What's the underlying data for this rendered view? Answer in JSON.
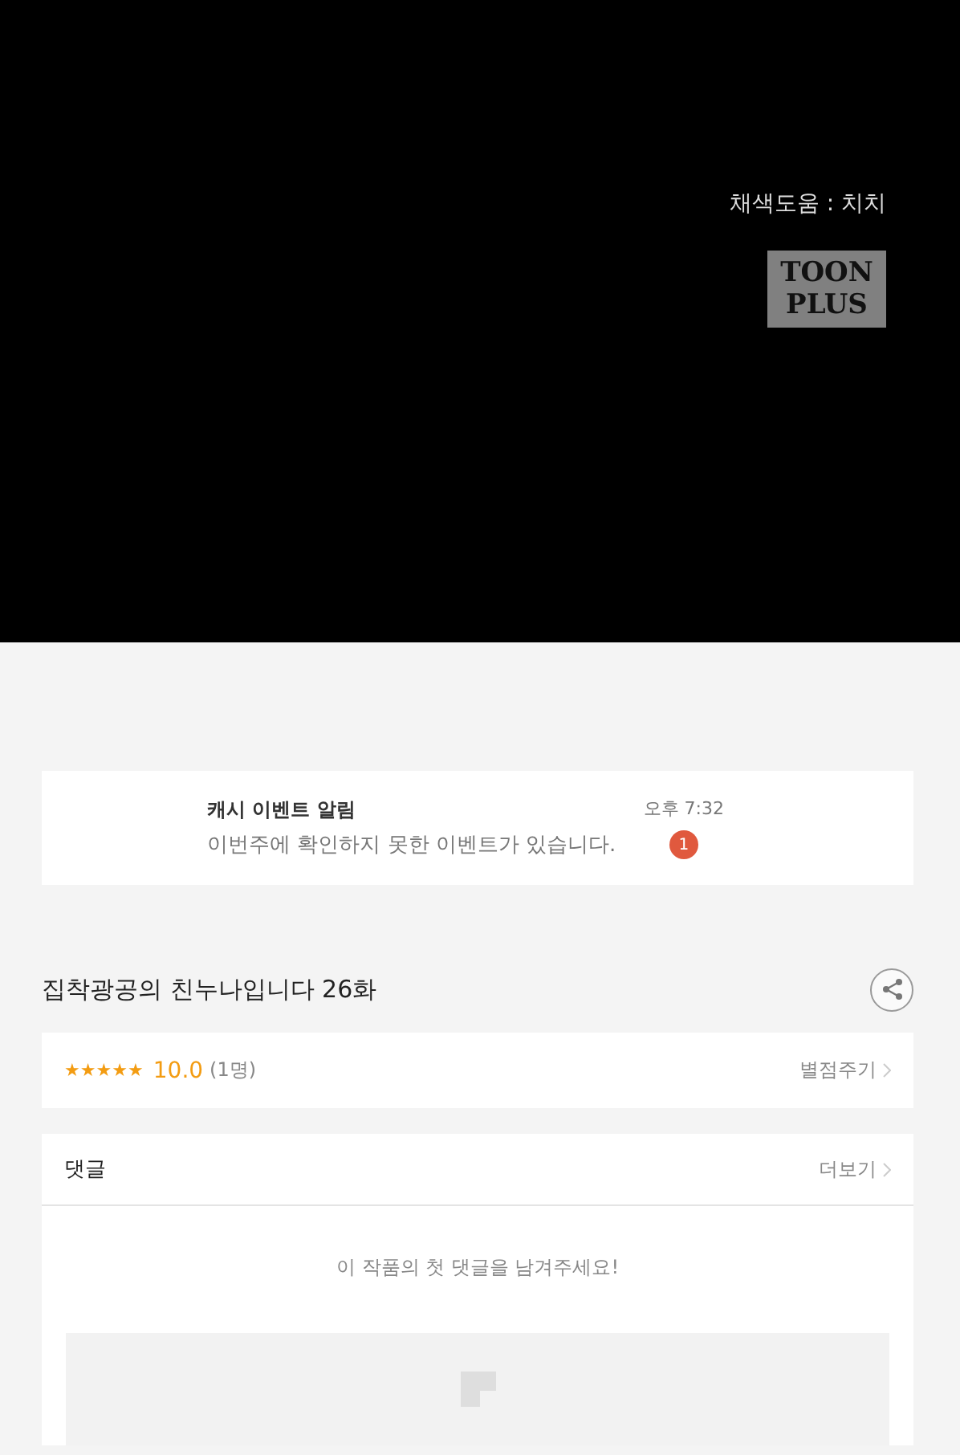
{
  "comic": {
    "credit": "채색도움 : 치치",
    "logo_lines": [
      "TOON",
      "PLUS"
    ]
  },
  "notification": {
    "title": "캐시 이벤트 알림",
    "message": "이번주에 확인하지 못한 이벤트가 있습니다.",
    "time": "오후 7:32",
    "badge": "1"
  },
  "episode": {
    "title": "집착광공의 친누나입니다 26화"
  },
  "rating": {
    "stars": 5,
    "score": "10.0",
    "count": "(1명)",
    "action": "별점주기"
  },
  "comments": {
    "title": "댓글",
    "more": "더보기",
    "empty_message": "이 작품의 첫 댓글을 남겨주세요!"
  }
}
